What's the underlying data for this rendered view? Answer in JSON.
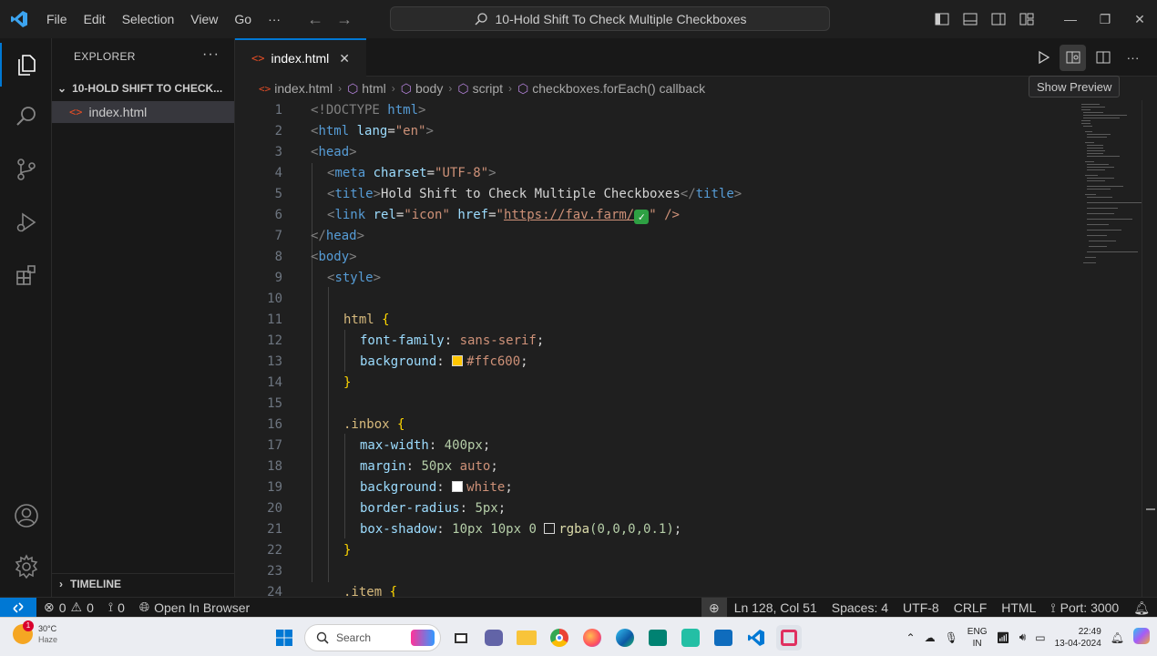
{
  "menu": [
    "File",
    "Edit",
    "Selection",
    "View",
    "Go"
  ],
  "menu_more": "···",
  "command_center": "10-Hold Shift To Check Multiple Checkboxes",
  "explorer": {
    "title": "EXPLORER",
    "more": "···",
    "folder": "10-HOLD SHIFT TO CHECK...",
    "file": "index.html",
    "timeline": "TIMELINE"
  },
  "tab": {
    "label": "index.html",
    "close": "✕"
  },
  "tooltip": "Show Preview",
  "breadcrumbs": [
    "index.html",
    "html",
    "body",
    "script",
    "checkboxes.forEach() callback"
  ],
  "code_lines": [
    {
      "n": "1"
    },
    {
      "n": "2"
    },
    {
      "n": "3"
    },
    {
      "n": "4"
    },
    {
      "n": "5"
    },
    {
      "n": "6"
    },
    {
      "n": "7"
    },
    {
      "n": "8"
    },
    {
      "n": "9"
    },
    {
      "n": "10"
    },
    {
      "n": "11"
    },
    {
      "n": "12"
    },
    {
      "n": "13"
    },
    {
      "n": "14"
    },
    {
      "n": "15"
    },
    {
      "n": "16"
    },
    {
      "n": "17"
    },
    {
      "n": "18"
    },
    {
      "n": "19"
    },
    {
      "n": "20"
    },
    {
      "n": "21"
    },
    {
      "n": "22"
    },
    {
      "n": "23"
    },
    {
      "n": "24"
    }
  ],
  "code": {
    "l1": [
      "<!DOCTYPE ",
      "html",
      ">"
    ],
    "l2": [
      "<",
      "html",
      " ",
      "lang",
      "=",
      "\"en\"",
      ">"
    ],
    "l3": [
      "<",
      "head",
      ">"
    ],
    "l4": [
      "<",
      "meta",
      " ",
      "charset",
      "=",
      "\"UTF-8\"",
      ">"
    ],
    "l5": [
      "<",
      "title",
      ">",
      "Hold Shift to Check Multiple Checkboxes",
      "</",
      "title",
      ">"
    ],
    "l6": [
      "<",
      "link",
      " ",
      "rel",
      "=",
      "\"icon\"",
      " ",
      "href",
      "=",
      "\"",
      "https://fav.farm/",
      "\" />"
    ],
    "l7": [
      "</",
      "head",
      ">"
    ],
    "l8": [
      "<",
      "body",
      ">"
    ],
    "l9": [
      "<",
      "style",
      ">"
    ],
    "l11": [
      "html",
      " {"
    ],
    "l12": [
      "font-family",
      ": ",
      "sans-serif",
      ";"
    ],
    "l13": [
      "background",
      ": ",
      "#ffc600",
      ";"
    ],
    "l14": [
      "}"
    ],
    "l16": [
      ".inbox",
      " {"
    ],
    "l17": [
      "max-width",
      ": ",
      "400px",
      ";"
    ],
    "l18": [
      "margin",
      ": ",
      "50px",
      " ",
      "auto",
      ";"
    ],
    "l19": [
      "background",
      ": ",
      "white",
      ";"
    ],
    "l20": [
      "border-radius",
      ": ",
      "5px",
      ";"
    ],
    "l21": [
      "box-shadow",
      ": ",
      "10px 10px 0 ",
      "rgba",
      "(0,0,0,0.1)",
      ";"
    ],
    "l22": [
      "}"
    ],
    "l24": [
      ".item",
      " {"
    ]
  },
  "colors": {
    "swatch_yellow": "#ffc600",
    "swatch_white": "#ffffff",
    "accent": "#0078d4"
  },
  "status": {
    "errors": "0",
    "warnings": "0",
    "ports": "0",
    "open_browser": "Open In Browser",
    "position": "Ln 128, Col 51",
    "spaces": "Spaces: 4",
    "encoding": "UTF-8",
    "eol": "CRLF",
    "language": "HTML",
    "port": "Port: 3000"
  },
  "taskbar": {
    "temp": "30°C",
    "weather": "Haze",
    "search": "Search",
    "lang_top": "ENG",
    "lang_bottom": "IN",
    "time": "22:49",
    "date": "13-04-2024"
  }
}
